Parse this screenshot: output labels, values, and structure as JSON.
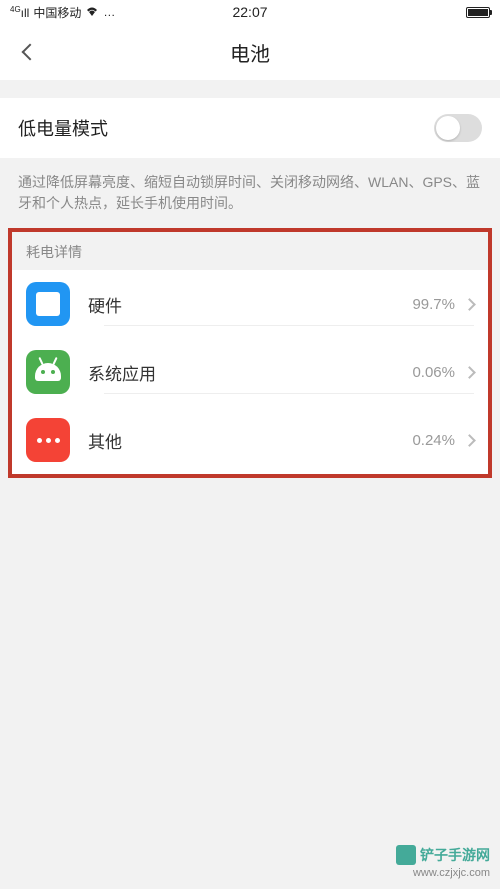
{
  "status_bar": {
    "signal_prefix": "4G",
    "carrier": "中国移动",
    "extra": "…",
    "time": "22:07"
  },
  "header": {
    "title": "电池"
  },
  "low_power": {
    "label": "低电量模式",
    "enabled": false,
    "description": "通过降低屏幕亮度、缩短自动锁屏时间、关闭移动网络、WLAN、GPS、蓝牙和个人热点，延长手机使用时间。"
  },
  "usage_section": {
    "header": "耗电详情",
    "items": [
      {
        "label": "硬件",
        "value": "99.7%",
        "icon": "hardware"
      },
      {
        "label": "系统应用",
        "value": "0.06%",
        "icon": "system"
      },
      {
        "label": "其他",
        "value": "0.24%",
        "icon": "other"
      }
    ]
  },
  "watermark": {
    "title": "铲子手游网",
    "url": "www.czjxjc.com"
  }
}
